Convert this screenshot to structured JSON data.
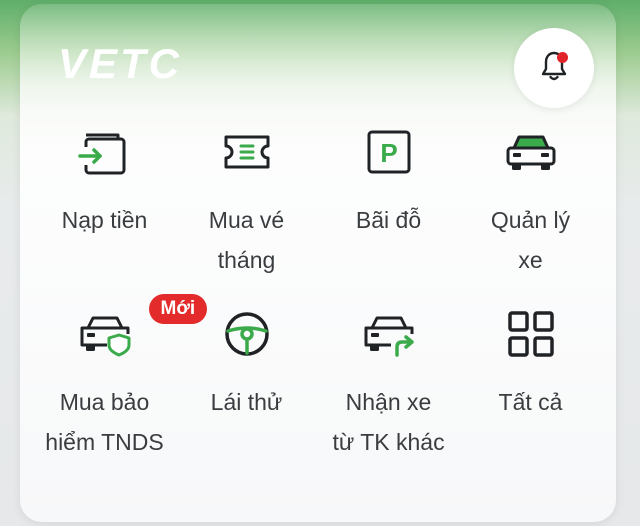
{
  "header": {
    "logo_text": "VETC",
    "bell_icon": "bell-icon",
    "has_notification": true
  },
  "menu": {
    "items": [
      {
        "label": "Nạp tiền",
        "icon": "wallet-topup-icon"
      },
      {
        "label": "Mua vé tháng",
        "icon": "ticket-icon"
      },
      {
        "label": "Bãi đỗ",
        "icon": "parking-icon"
      },
      {
        "label": "Quản lý xe",
        "icon": "car-icon"
      },
      {
        "label": "Mua bảo hiểm TNDS",
        "icon": "car-insurance-icon",
        "badge": "Mới"
      },
      {
        "label": "Lái thử",
        "icon": "steering-wheel-icon"
      },
      {
        "label": "Nhận xe từ TK khác",
        "icon": "car-transfer-icon"
      },
      {
        "label": "Tất cả",
        "icon": "grid-all-icon"
      }
    ]
  },
  "colors": {
    "icon_dark": "#1f2326",
    "icon_green": "#3aaa4a",
    "badge_red": "#e32b2b",
    "label_text": "#3a3d40"
  }
}
